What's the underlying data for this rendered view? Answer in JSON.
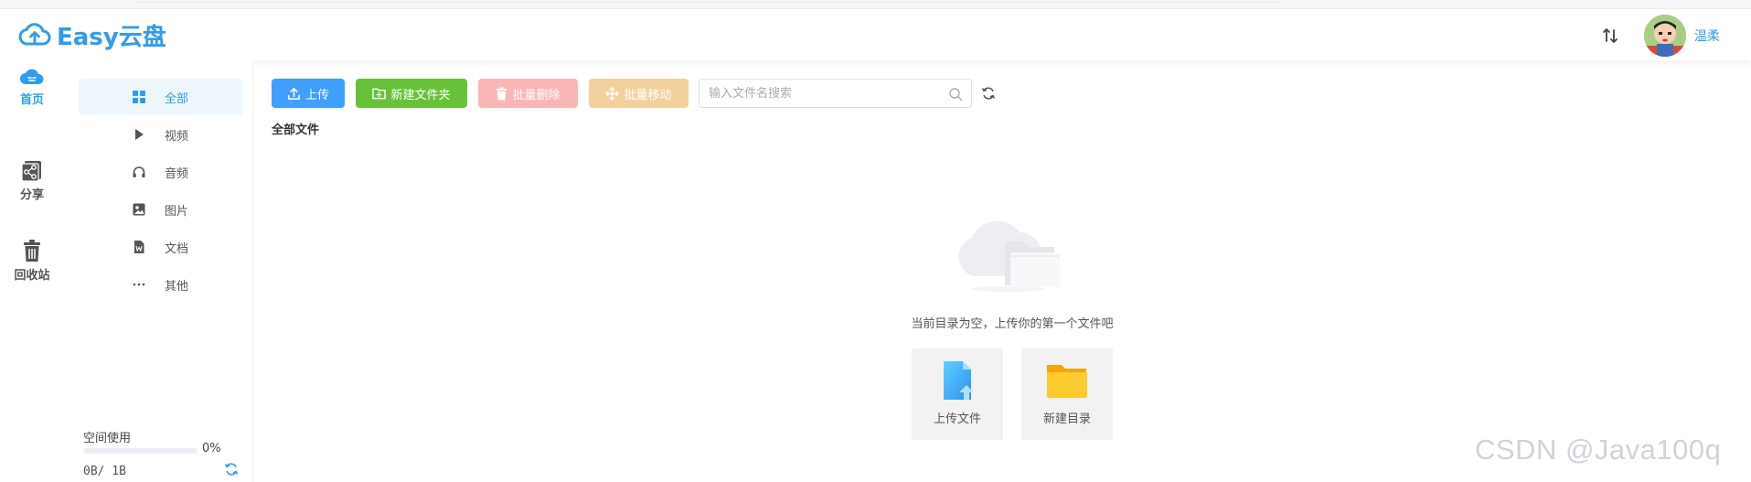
{
  "app": {
    "brand": "Easy云盘",
    "username": "温柔"
  },
  "colors": {
    "primary": "#409eff",
    "success": "#67c23a",
    "danger_disabled": "#fab6b6",
    "warning_disabled": "#f3d19e",
    "brand_blue": "#2f9cf1"
  },
  "rail": {
    "items": [
      {
        "label": "首页",
        "icon": "cloud-home-icon",
        "active": true
      },
      {
        "label": "分享",
        "icon": "share-icon",
        "active": false
      },
      {
        "label": "回收站",
        "icon": "trash-icon",
        "active": false
      }
    ]
  },
  "submenu": {
    "items": [
      {
        "label": "全部",
        "icon": "grid-icon",
        "active": true
      },
      {
        "label": "视频",
        "icon": "play-icon"
      },
      {
        "label": "音频",
        "icon": "headphones-icon"
      },
      {
        "label": "图片",
        "icon": "image-icon"
      },
      {
        "label": "文档",
        "icon": "document-icon"
      },
      {
        "label": "其他",
        "icon": "more-dots-icon"
      }
    ]
  },
  "space": {
    "title": "空间使用",
    "percent_label": "0%",
    "percent": 0,
    "used": "0B/ 1B"
  },
  "toolbar": {
    "upload": "上传",
    "new_folder": "新建文件夹",
    "batch_delete": "批量删除",
    "batch_move": "批量移动",
    "search_placeholder": "输入文件名搜索",
    "search_value": ""
  },
  "breadcrumb": "全部文件",
  "empty": {
    "message": "当前目录为空，上传你的第一个文件吧",
    "upload_file": "上传文件",
    "new_dir": "新建目录"
  },
  "watermark": "CSDN @Java100q"
}
